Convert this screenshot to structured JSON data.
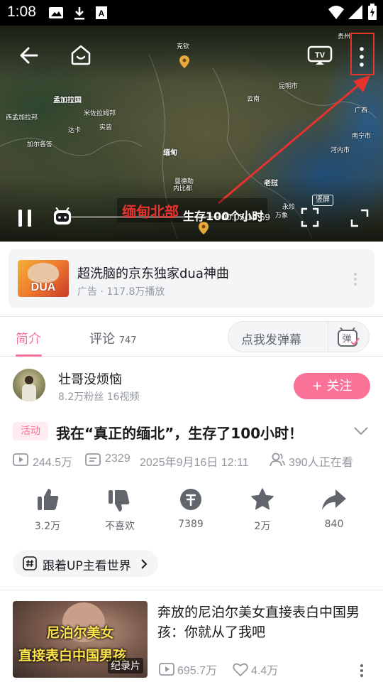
{
  "status_bar": {
    "time": "1:08"
  },
  "player": {
    "map_labels": [
      "克钦",
      "昆明市",
      "孟加拉国",
      "西孟加拉邦",
      "达卡",
      "加尔各答",
      "米佐拉姆邦",
      "云南",
      "缅甸",
      "河内市",
      "老挝",
      "实皆",
      "曼德勒",
      "内比都",
      "永珍",
      "万象",
      "贵州",
      "南宁市",
      "广西"
    ],
    "subtitle_red": "缅甸北部",
    "subtitle_white": "生存100个小时",
    "timecode": "00:05/13:59",
    "portrait_badge": "竖屏",
    "progress_fraction": 0.004
  },
  "ad": {
    "thumb_text": "DUA",
    "title": "超洗脑的京东独家dua神曲",
    "sub": "广告 · 117.8万播放"
  },
  "tabs": {
    "intro": "简介",
    "comments": "评论",
    "comments_count": "747",
    "danmaku_placeholder": "点我发弹幕",
    "danmaku_icon_text": "弹"
  },
  "uploader": {
    "name": "壮哥没烦恼",
    "stats": "8.2万粉丝   16视频",
    "follow": "+ 关注"
  },
  "video": {
    "activity_tag": "活动",
    "title": "我在“真正的缅北”，生存了100小时！",
    "plays": "244.5万",
    "danmaku": "2329",
    "date": "2025年9月16日 12:11",
    "watching": "390人正在看"
  },
  "actions": [
    {
      "label": "3.2万"
    },
    {
      "label": "不喜欢"
    },
    {
      "label": "7389"
    },
    {
      "label": "2万"
    },
    {
      "label": "840"
    }
  ],
  "tag_chip": "跟着UP主看世界",
  "recommend": {
    "thumb_line1": "尼泊尔美女",
    "thumb_line2": "直接表白中国男孩",
    "badge": "纪录片",
    "title": "奔放的尼泊尔美女直接表白中国男孩：你就从了我吧",
    "plays": "695.7万",
    "likes": "4.4万"
  },
  "colors": {
    "accent": "#fb7299",
    "annotation_red": "#e8322e"
  }
}
